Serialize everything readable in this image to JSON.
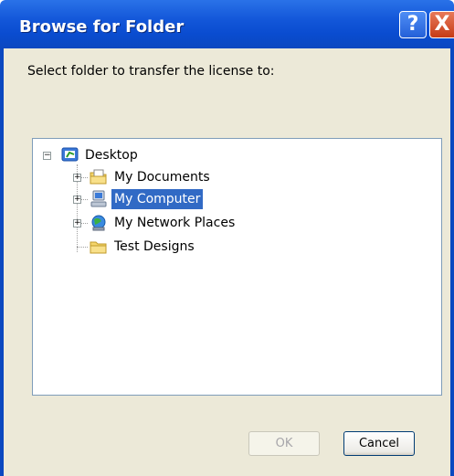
{
  "window": {
    "title": "Browse for Folder"
  },
  "titlebar": {
    "help_glyph": "?",
    "close_glyph": "X"
  },
  "prompt": "Select folder to transfer the license to:",
  "tree": {
    "root": {
      "label": "Desktop",
      "icon": "desktop-icon",
      "expander": "−"
    },
    "items": [
      {
        "label": "My Documents",
        "icon": "documents-folder-icon",
        "expander": "+"
      },
      {
        "label": "My Computer",
        "icon": "computer-icon",
        "expander": "+",
        "selected": true
      },
      {
        "label": "My Network Places",
        "icon": "network-places-icon",
        "expander": "+"
      },
      {
        "label": "Test Designs",
        "icon": "folder-icon"
      }
    ]
  },
  "buttons": {
    "ok": "OK",
    "cancel": "Cancel"
  },
  "colors": {
    "title_bar": "#0b48c0",
    "dialog_bg": "#ece9d8",
    "selection": "#316ac5"
  }
}
